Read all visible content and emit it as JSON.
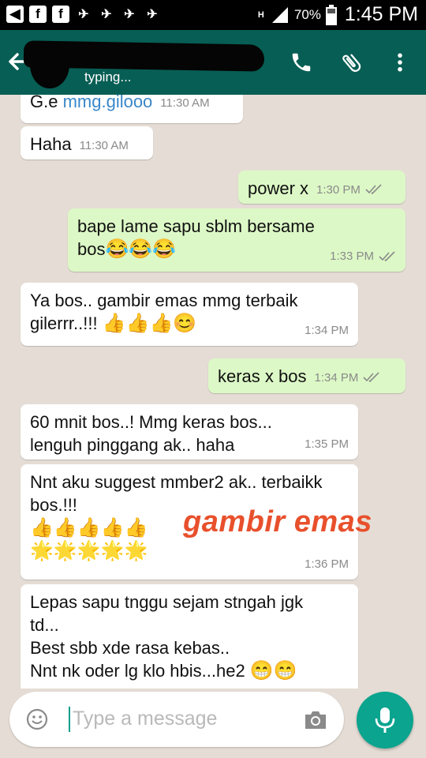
{
  "status_bar": {
    "icons": [
      "back-square-icon",
      "facebook-icon",
      "facebook-icon",
      "airplane-icon",
      "airplane-icon",
      "airplane-icon",
      "airplane-icon"
    ],
    "network": "H",
    "battery": "70%",
    "time": "1:45 PM"
  },
  "header": {
    "status": "typing...",
    "icons": [
      "back-arrow-icon",
      "phone-icon",
      "paperclip-icon",
      "more-vert-icon"
    ]
  },
  "messages": [
    {
      "dir": "in",
      "text_parts": [
        "G.e ",
        "mmg.gilooo"
      ],
      "time": "11:30 AM"
    },
    {
      "dir": "in",
      "text": "Haha",
      "time": "11:30 AM"
    },
    {
      "dir": "out",
      "text": "power x",
      "time": "1:30 PM"
    },
    {
      "dir": "out",
      "text_line1": "bape lame sapu sblm bersame",
      "text_line2": "bos",
      "emoji": "😂😂😂",
      "time": "1:33 PM"
    },
    {
      "dir": "in",
      "text_line1": "Ya bos.. gambir emas mmg terbaik",
      "text_line2": "gilerrr..!!! ",
      "emoji": "👍👍👍😊",
      "time": "1:34 PM"
    },
    {
      "dir": "out",
      "text": "keras x bos",
      "time": "1:34 PM"
    },
    {
      "dir": "in",
      "text_line1": "60 mnit bos..! Mmg keras bos...",
      "text_line2": "lenguh pinggang ak.. haha",
      "time": "1:35 PM"
    },
    {
      "dir": "in",
      "text_line1": "Nnt aku suggest mmber2 ak.. terbaikk",
      "text_line2": "bos.!!!",
      "emoji_line1": "👍👍👍👍👍",
      "emoji_line2": "🌟🌟🌟🌟🌟",
      "time": "1:36 PM"
    },
    {
      "dir": "in",
      "text_line1": "Lepas sapu tnggu sejam stngah jgk",
      "text_line2": "td...",
      "text_line3": "Best sbb xde rasa kebas..",
      "text_line4": "Nnt nk oder lg klo hbis...he2 ",
      "emoji": "😁😁"
    }
  ],
  "overlay_text": "gambir emas",
  "input": {
    "placeholder": "Type a message"
  },
  "colors": {
    "header": "#075e54",
    "outgoing_bubble": "#dcf8c6",
    "incoming_bubble": "#ffffff",
    "chat_background": "#e5ddd5",
    "accent": "#0aa48f",
    "overlay_text": "#e8502c",
    "link": "#3a87c9"
  }
}
